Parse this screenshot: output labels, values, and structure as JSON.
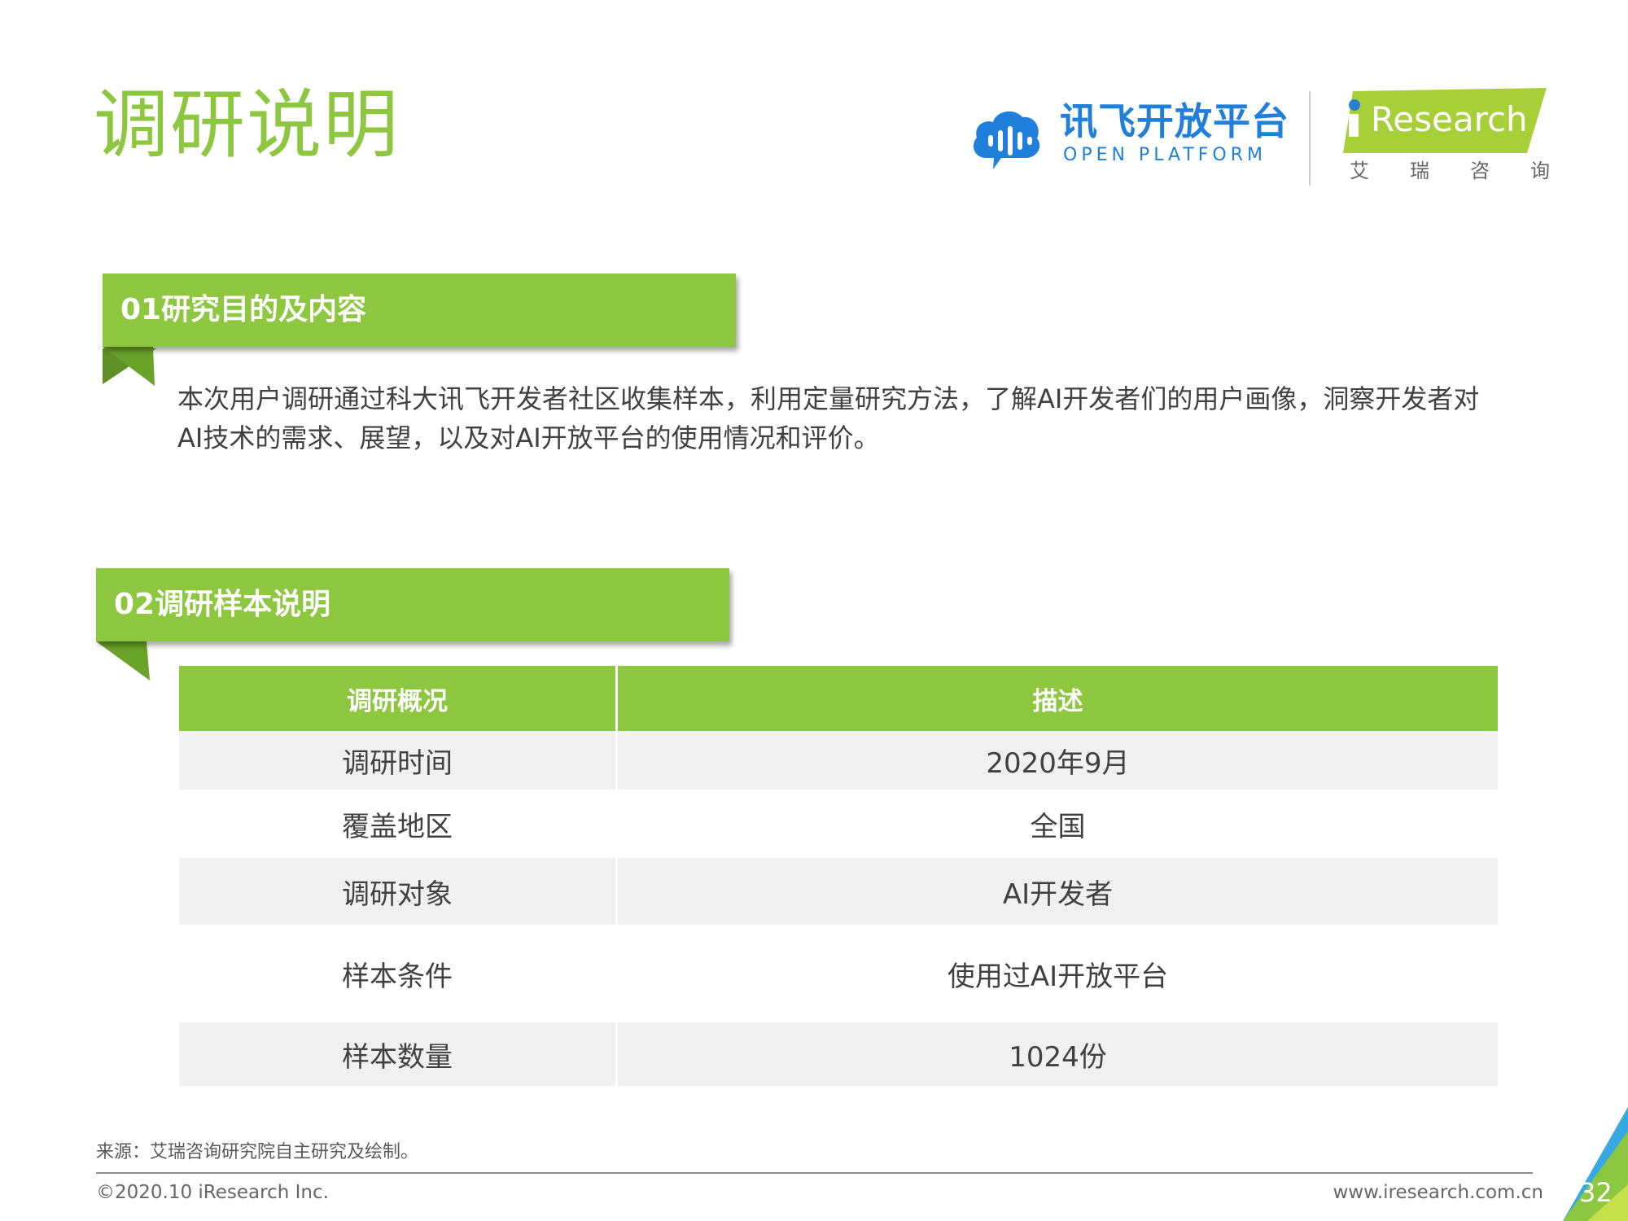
{
  "title": "调研说明",
  "logos": {
    "xunfei_cn": "讯飞开放平台",
    "xunfei_en": "OPEN PLATFORM",
    "iresearch_en": "Research",
    "iresearch_cn": "艾瑞咨询"
  },
  "section1": {
    "heading": "01研究目的及内容",
    "body": "本次用户调研通过科大讯飞开发者社区收集样本，利用定量研究方法，了解AI开发者们的用户画像，洞察开发者对AI技术的需求、展望，以及对AI开放平台的使用情况和评价。"
  },
  "section2": {
    "heading": "02调研样本说明",
    "table": {
      "headers": [
        "调研概况",
        "描述"
      ],
      "rows": [
        [
          "调研时间",
          "2020年9月"
        ],
        [
          "覆盖地区",
          "全国"
        ],
        [
          "调研对象",
          "AI开发者"
        ],
        [
          "样本条件",
          "使用过AI开放平台"
        ],
        [
          "样本数量",
          "1024份"
        ]
      ]
    }
  },
  "footer": {
    "source": "来源：艾瑞咨询研究院自主研究及绘制。",
    "copyright": "©2020.10 iResearch Inc.",
    "website": "www.iresearch.com.cn",
    "page_number": "32"
  },
  "colors": {
    "accent_green": "#8dc63f",
    "xunfei_blue": "#1f7fdb",
    "corner_blue": "#36a9e1"
  }
}
